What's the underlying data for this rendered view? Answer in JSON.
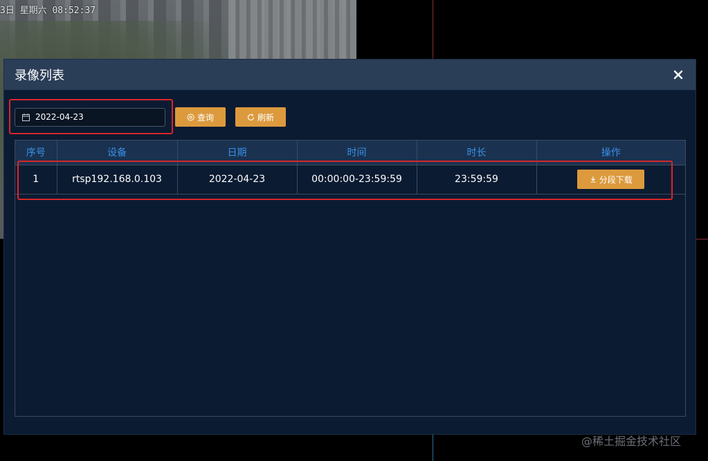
{
  "background": {
    "osd_text": "3日 星期六 08:52:37"
  },
  "dialog": {
    "title": "录像列表",
    "close_icon": "close-icon",
    "date_value": "2022-04-23",
    "query_label": "查询",
    "refresh_label": "刷新"
  },
  "table": {
    "headers": [
      "序号",
      "设备",
      "日期",
      "时间",
      "时长",
      "操作"
    ],
    "rows": [
      {
        "index": "1",
        "device": "rtsp192.168.0.103",
        "date": "2022-04-23",
        "time": "00:00:00-23:59:59",
        "duration": "23:59:59",
        "action": "分段下载"
      }
    ]
  },
  "watermark": "@稀土掘金技术社区",
  "colors": {
    "accent": "#dc9a3d",
    "header_text": "#3a8ee6",
    "dialog_bg": "#0b1b32",
    "highlight": "#d9262a"
  }
}
